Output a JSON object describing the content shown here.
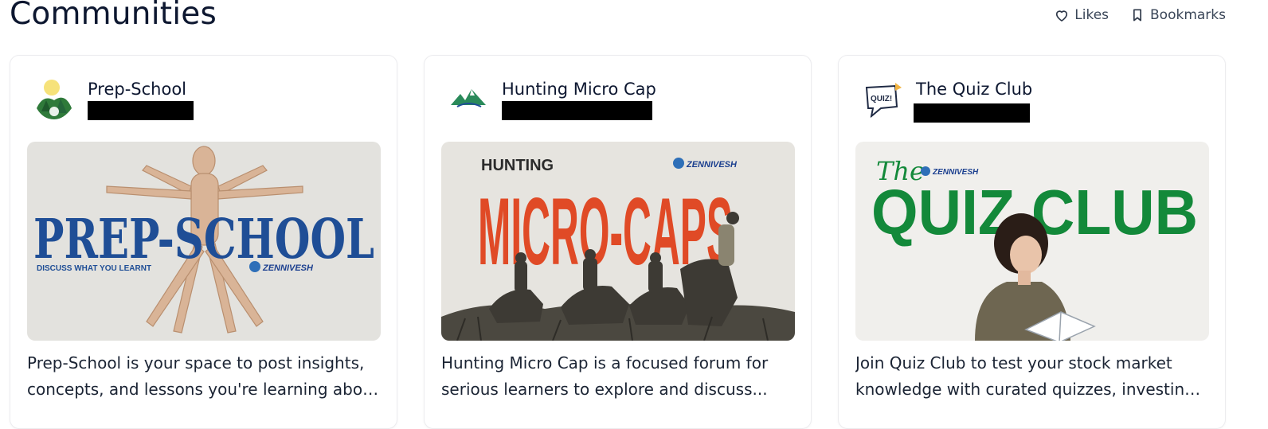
{
  "header": {
    "title": "Communities",
    "likes_label": "Likes",
    "bookmarks_label": "Bookmarks"
  },
  "cards": [
    {
      "name": "Prep-School",
      "banner": {
        "headline": "PREP-SCHOOL",
        "tagline": "DISCUSS WHAT YOU LEARNT",
        "brand": "ZENNIVESH"
      },
      "description": {
        "line1": "Prep-School is your space to post insights,",
        "line2": "concepts, and lessons you're learning abou..."
      }
    },
    {
      "name": "Hunting Micro Cap",
      "banner": {
        "kicker": "HUNTING",
        "headline": "MICRO-CAPS",
        "brand": "ZENNIVESH"
      },
      "description": {
        "line1": "Hunting Micro Cap is a focused forum for",
        "line2": "serious learners to explore and discuss..."
      }
    },
    {
      "name": "The Quiz Club",
      "avatar_text": "QUIZ!",
      "banner": {
        "script": "The",
        "headline": "QUIZ CLUB",
        "brand": "ZENNIVESH"
      },
      "description": {
        "line1": "Join Quiz Club to test your stock market",
        "line2": "knowledge with curated quizzes, investing..."
      }
    }
  ],
  "colors": {
    "prep_blue": "#1f4e96",
    "micro_orange": "#e04a26",
    "quiz_green": "#13893a",
    "brand_blue": "#1b3f8f"
  }
}
